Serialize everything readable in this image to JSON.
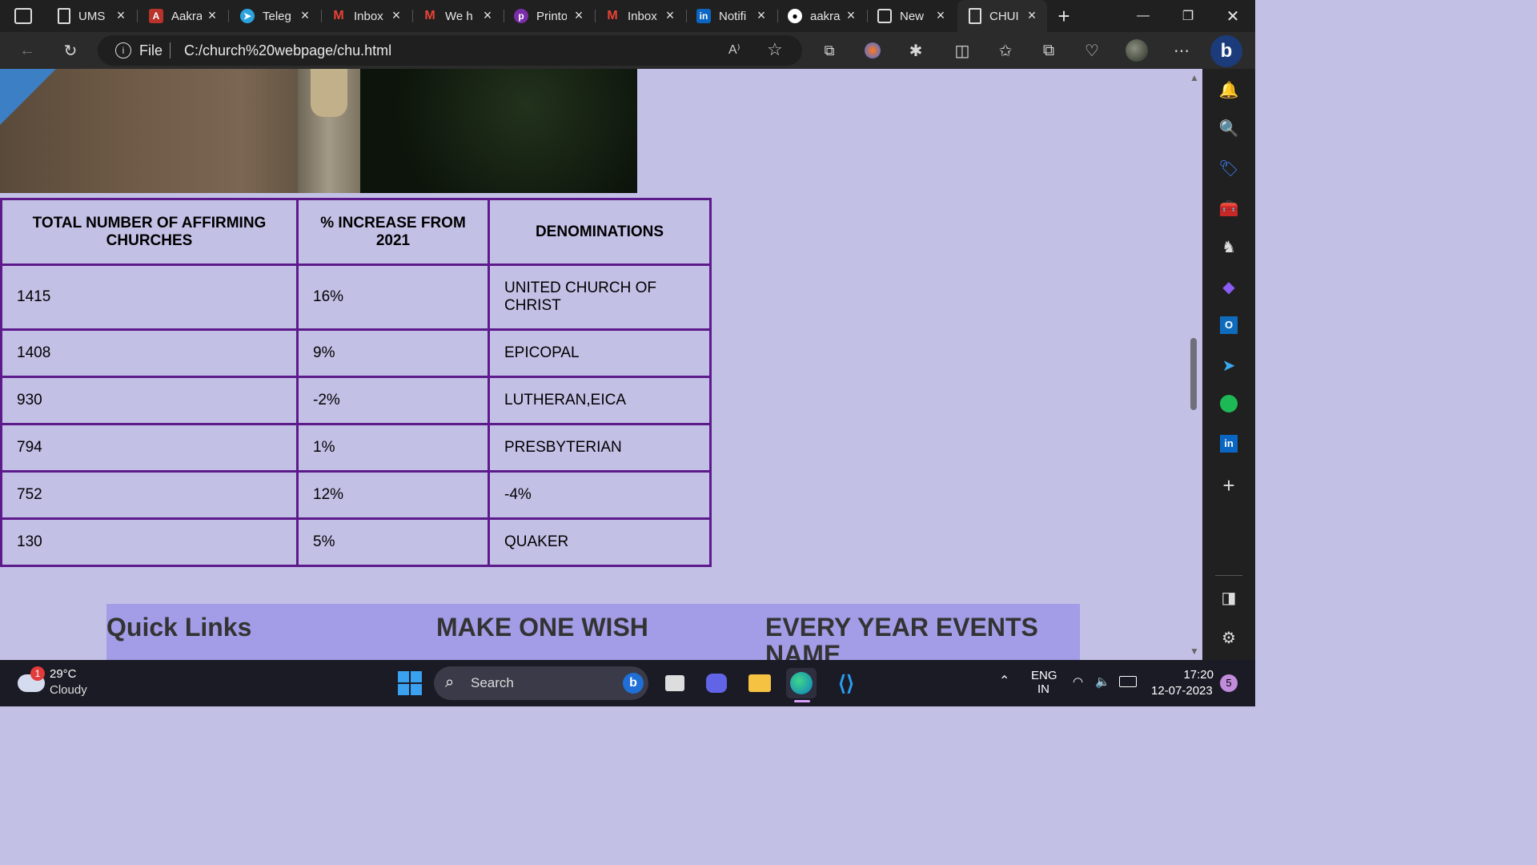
{
  "tabs": [
    {
      "title": "UMS",
      "icon": "page-icon"
    },
    {
      "title": "Aakra",
      "icon": "avatar-icon"
    },
    {
      "title": "Teleg",
      "icon": "telegram-icon"
    },
    {
      "title": "Inbox",
      "icon": "gmail-icon"
    },
    {
      "title": "We h",
      "icon": "gmail-icon"
    },
    {
      "title": "Printo",
      "icon": "printo-icon"
    },
    {
      "title": "Inbox",
      "icon": "gmail-icon"
    },
    {
      "title": "Notifi",
      "icon": "linkedin-icon"
    },
    {
      "title": "aakra",
      "icon": "github-icon"
    },
    {
      "title": "New",
      "icon": "newtab-icon"
    },
    {
      "title": "CHUI",
      "icon": "page-icon"
    }
  ],
  "address": {
    "scheme": "File",
    "url": "C:/church%20webpage/chu.html"
  },
  "table": {
    "headers": [
      "TOTAL NUMBER OF AFFIRMING CHURCHES",
      "% INCREASE FROM 2021",
      "DENOMINATIONS"
    ],
    "rows": [
      [
        "1415",
        "16%",
        "UNITED CHURCH OF CHRIST"
      ],
      [
        "1408",
        "9%",
        "EPICOPAL"
      ],
      [
        "930",
        "-2%",
        "LUTHERAN,EICA"
      ],
      [
        "794",
        "1%",
        "PRESBYTERIAN"
      ],
      [
        "752",
        "12%",
        "-4%"
      ],
      [
        "130",
        "5%",
        "QUAKER"
      ]
    ]
  },
  "footer": {
    "col1": "Quick Links",
    "col2": "MAKE ONE WISH",
    "col3": "EVERY YEAR EVENTS NAME"
  },
  "taskbar": {
    "weather_badge": "1",
    "temperature": "29°C",
    "condition": "Cloudy",
    "search_label": "Search",
    "lang1": "ENG",
    "lang2": "IN",
    "time": "17:20",
    "date": "12-07-2023",
    "notification_count": "5"
  },
  "colors": {
    "page_bg": "#c3c0e6",
    "table_border": "#5d1a8b",
    "footer_bg": "#a29de6"
  }
}
